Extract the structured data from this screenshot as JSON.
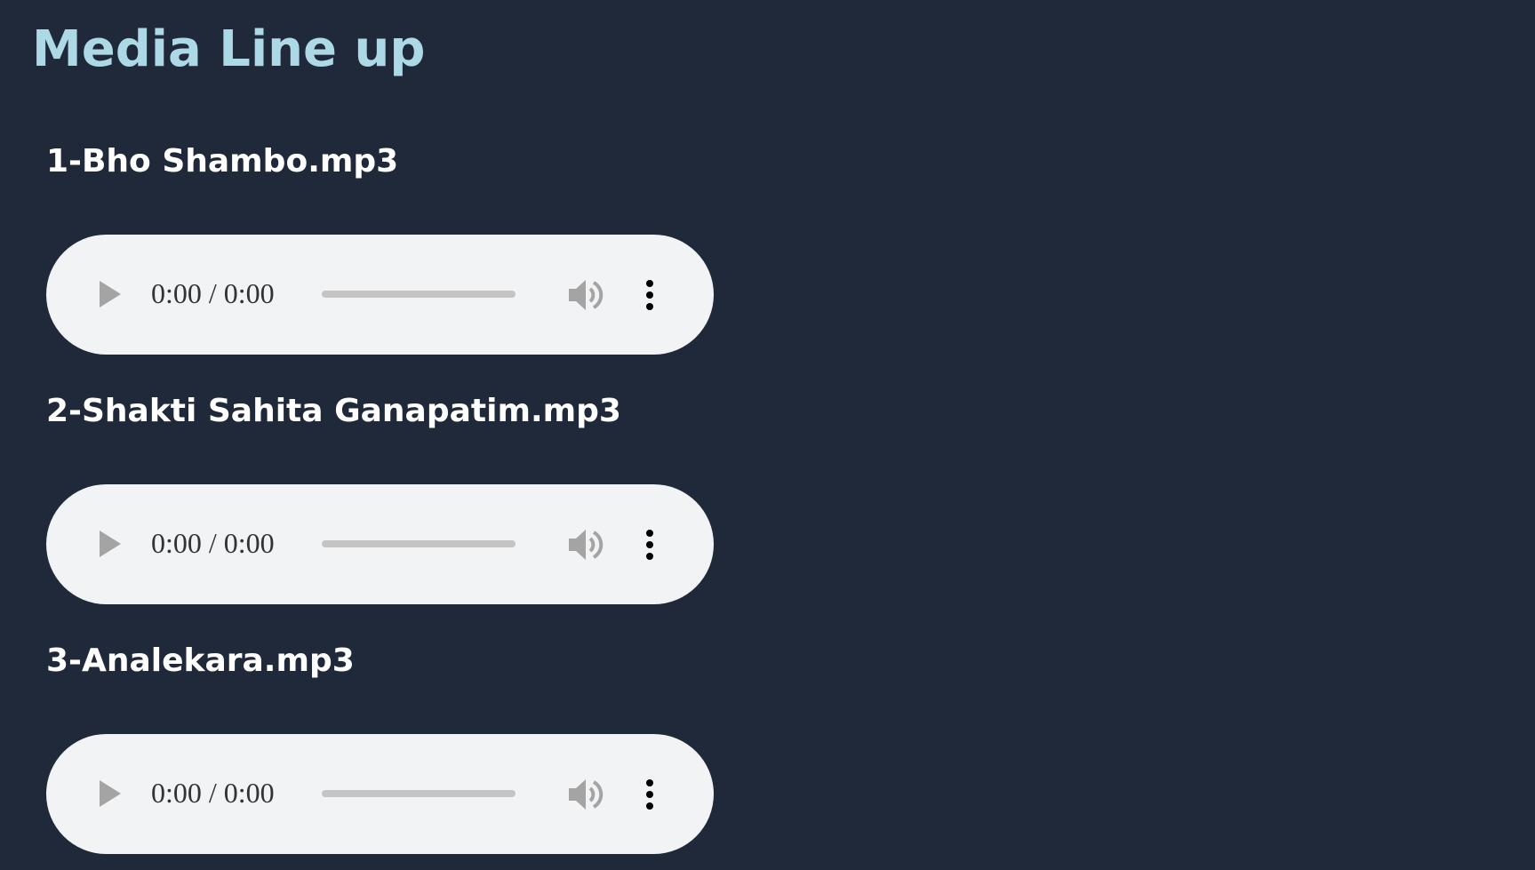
{
  "page": {
    "title": "Media Line up"
  },
  "tracks": [
    {
      "title": "1-Bho Shambo.mp3",
      "time": "0:00 / 0:00",
      "progress": 0
    },
    {
      "title": "2-Shakti Sahita Ganapatim.mp3",
      "time": "0:00 / 0:00",
      "progress": 0
    },
    {
      "title": "3-Analekara.mp3",
      "time": "0:00 / 0:00",
      "progress": 0
    }
  ],
  "icons": {
    "play": "play-icon",
    "volume": "volume-icon",
    "more": "more-options-icon"
  },
  "colors": {
    "background": "#20293a",
    "title": "#add8e6",
    "track_title": "#ffffff",
    "player_bg": "#f1f3f4",
    "icon_disabled": "#a4a4a4"
  }
}
